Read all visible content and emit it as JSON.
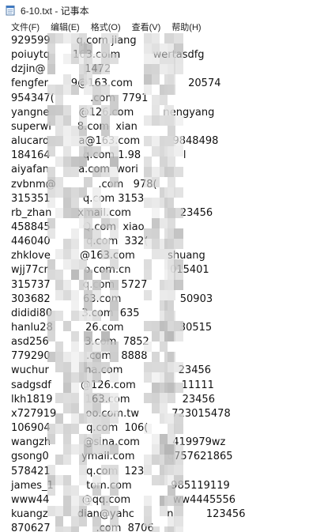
{
  "window": {
    "title": "6-10.txt - 记事本",
    "icon": "notepad-icon"
  },
  "menu": [
    {
      "label": "文件(F)"
    },
    {
      "label": "编辑(E)"
    },
    {
      "label": "格式(O)"
    },
    {
      "label": "查看(V)"
    },
    {
      "label": "帮助(H)"
    }
  ],
  "lines": [
    "929599        q.com jiang",
    "poiuytq       163.coim          wertasdfg",
    "dzjin@            1472",
    "fengfer       9@163.com                 20574",
    "954347(           .com  7791",
    "yangne         @126.com         nengyang",
    "superwi        8.com  xian",
    "alucard         a@163.com          9848498",
    "184164          q.com 1.98             l",
    "aiyafan         a.com  wori",
    "zvbnm@             .com   978(",
    "315351          q.com 3153",
    "rb_zhan        xmail.com               23456",
    "458845          Q.com  xiao",
    "446040           q.com  332(",
    "zhklove         @163.com          shuang",
    "wjj77cr           o.com.cn            015401",
    "315737          q.com  5727",
    "303682          63.com                  50903",
    "dididi80         3.com  635",
    "hanlu28          26.com                 30515",
    "asd256           3.com  7852",
    "779290           .com   8888",
    "wuchur           na.com                 23456",
    "sadgsdf         @126.com              11111",
    "lkh1819          163.com                23456",
    "x727919         oo.com.tw          723015478",
    "106904           q.com  106(",
    "wangzh          @sina.com          419979wz",
    "gsong0          ymail.com          q757621865",
    "578421           q.com  123",
    "james_1          tom.com            985119119",
    "www44          @qq.com             ww4445556",
    "kuangz         dian@yahc          n          123456",
    "870627              .com  8706"
  ],
  "accent": "#0a64c8"
}
